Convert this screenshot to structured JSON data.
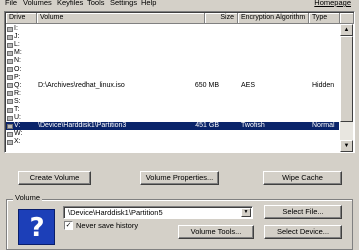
{
  "menu": {
    "items": [
      "File",
      "Volumes",
      "Keyfiles",
      "Tools",
      "Settings",
      "Help"
    ],
    "homepage": "Homepage"
  },
  "list": {
    "columns": {
      "drive": "Drive",
      "volume": "Volume",
      "size": "Size",
      "algorithm": "Encryption Algorithm",
      "type": "Type"
    },
    "rows": [
      {
        "drive": "I:",
        "path": "",
        "size": "",
        "algorithm": "",
        "type": ""
      },
      {
        "drive": "J:",
        "path": "",
        "size": "",
        "algorithm": "",
        "type": ""
      },
      {
        "drive": "L:",
        "path": "",
        "size": "",
        "algorithm": "",
        "type": ""
      },
      {
        "drive": "M:",
        "path": "",
        "size": "",
        "algorithm": "",
        "type": ""
      },
      {
        "drive": "N:",
        "path": "",
        "size": "",
        "algorithm": "",
        "type": ""
      },
      {
        "drive": "O:",
        "path": "",
        "size": "",
        "algorithm": "",
        "type": ""
      },
      {
        "drive": "P:",
        "path": "",
        "size": "",
        "algorithm": "",
        "type": ""
      },
      {
        "drive": "Q:",
        "path": "D:\\Archives\\redhat_linux.iso",
        "size": "650 MB",
        "algorithm": "AES",
        "type": "Hidden"
      },
      {
        "drive": "R:",
        "path": "",
        "size": "",
        "algorithm": "",
        "type": ""
      },
      {
        "drive": "S:",
        "path": "",
        "size": "",
        "algorithm": "",
        "type": ""
      },
      {
        "drive": "T:",
        "path": "",
        "size": "",
        "algorithm": "",
        "type": ""
      },
      {
        "drive": "U:",
        "path": "",
        "size": "",
        "algorithm": "",
        "type": ""
      },
      {
        "drive": "V:",
        "path": "\\Device\\Harddisk1\\Partition3",
        "size": "451 GB",
        "algorithm": "Twofish",
        "type": "Normal",
        "selected": true
      },
      {
        "drive": "W:",
        "path": "",
        "size": "",
        "algorithm": "",
        "type": ""
      },
      {
        "drive": "X:",
        "path": "",
        "size": "",
        "algorithm": "",
        "type": ""
      }
    ]
  },
  "buttons": {
    "create_volume": "Create Volume",
    "volume_properties": "Volume Properties...",
    "wipe_cache": "Wipe Cache",
    "select_file": "Select File...",
    "volume_tools": "Volume Tools...",
    "select_device": "Select Device..."
  },
  "volume": {
    "group_label": "Volume",
    "path_value": "\\Device\\Harddisk1\\Partition5",
    "never_save_history": "Never save history",
    "never_save_history_checked": true
  },
  "icons": {
    "logo": "key-logo-icon",
    "scroll_up": "scroll-up-icon",
    "scroll_down": "scroll-down-icon",
    "combo_arrow": "chevron-down-icon",
    "drive": "drive-icon"
  },
  "colors": {
    "selection": "#0a246a",
    "window_bg": "#d4d0c8",
    "logo_bg": "#1c3fb8"
  }
}
